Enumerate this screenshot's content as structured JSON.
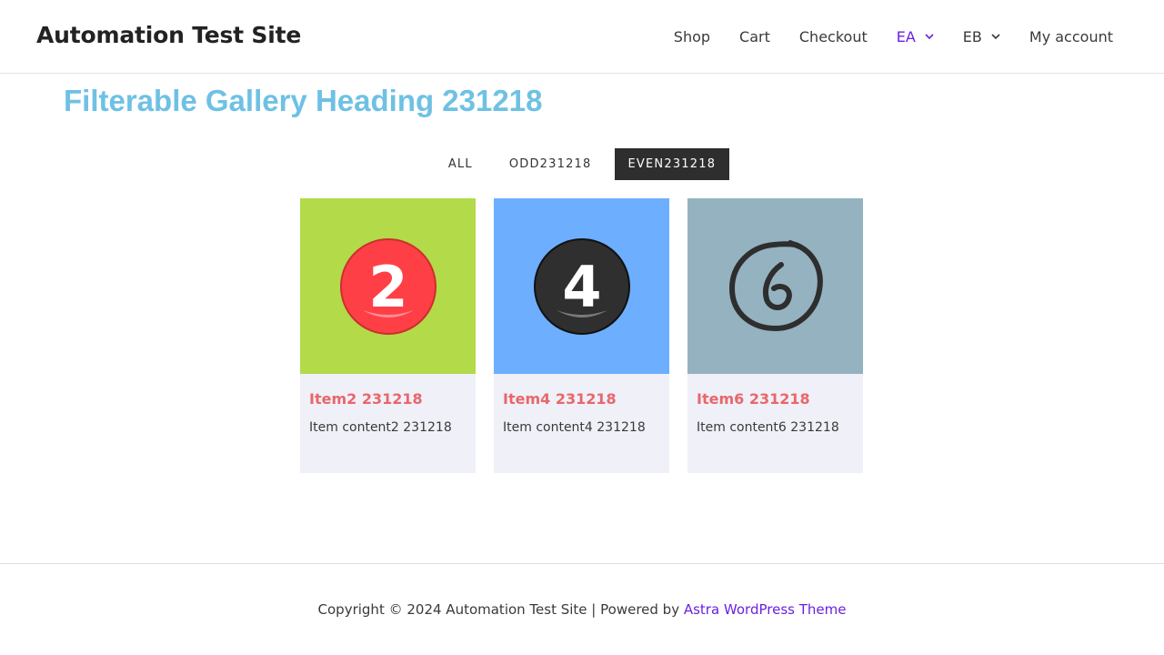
{
  "header": {
    "site_title": "Automation Test Site",
    "nav": [
      {
        "label": "Shop"
      },
      {
        "label": "Cart"
      },
      {
        "label": "Checkout"
      },
      {
        "label": "EA"
      },
      {
        "label": "EB"
      },
      {
        "label": "My account"
      }
    ]
  },
  "main": {
    "heading": "Filterable Gallery Heading 231218",
    "filters": [
      {
        "label": "ALL"
      },
      {
        "label": "ODD231218"
      },
      {
        "label": "EVEN231218"
      }
    ],
    "items": [
      {
        "title": "Item2 231218",
        "content": "Item content2 231218",
        "bg_color": "#b3da48",
        "number": "2"
      },
      {
        "title": "Item4 231218",
        "content": "Item content4 231218",
        "bg_color": "#6eaeff",
        "number": "4"
      },
      {
        "title": "Item6 231218",
        "content": "Item content6 231218",
        "bg_color": "#95b2c0",
        "number": "6"
      }
    ]
  },
  "footer": {
    "text_prefix": "Copyright © 2024 Automation Test Site | Powered by ",
    "link_label": "Astra WordPress Theme"
  },
  "colors": {
    "accent": "#6b21e0",
    "heading": "#6ec1e4",
    "item_title": "#e8676b",
    "active_filter_bg": "#2e2e2e"
  }
}
